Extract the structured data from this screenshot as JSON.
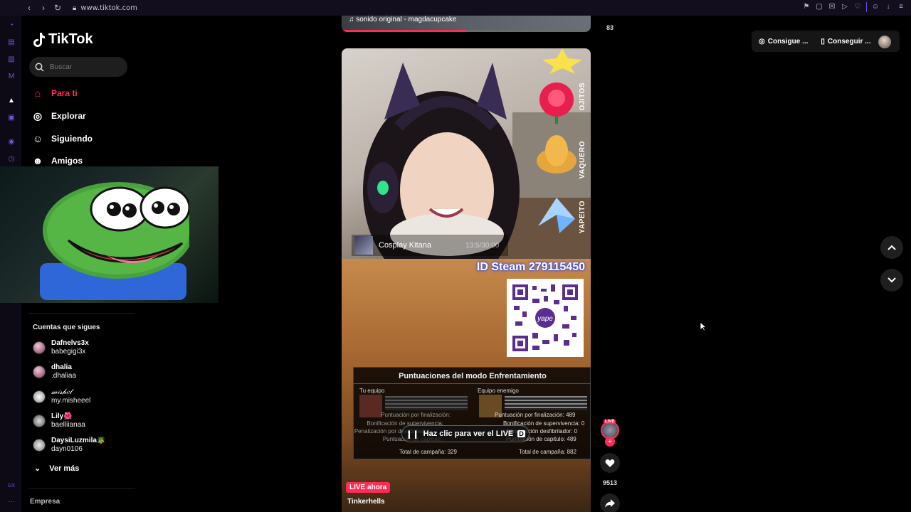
{
  "browser": {
    "url": "www.tiktok.com"
  },
  "sidebar": {
    "logo": "TikTok",
    "search_placeholder": "Buscar",
    "nav": [
      {
        "label": "Para ti",
        "icon": "home-icon",
        "active": true
      },
      {
        "label": "Explorar",
        "icon": "compass-icon",
        "active": false
      },
      {
        "label": "Siguiendo",
        "icon": "following-icon",
        "active": false
      },
      {
        "label": "Amigos",
        "icon": "friends-icon",
        "active": false
      }
    ],
    "following_title": "Cuentas que sigues",
    "accounts": [
      {
        "name": "Dafnelvs3x",
        "handle": "babegigi3x"
      },
      {
        "name": "dhalia",
        "handle": ".dhaliaa"
      },
      {
        "name": "𝓂𝒾𝓈𝒽𝑒𝓁",
        "handle": "my.misheeel"
      },
      {
        "name": "Lily🌺",
        "handle": "baelliianaa"
      },
      {
        "name": "DaysiLuzmila🪴",
        "handle": "dayn0106"
      }
    ],
    "see_more": "Ver más",
    "company": "Empresa"
  },
  "feed": {
    "prev_caption": "♫ sonido original - magdacupcake",
    "prev_progress": 0.5,
    "cosplay_title": "Cosplay Kitana",
    "cosplay_timer": "13:5/30:00",
    "gift_labels": [
      "OJITOS",
      "VAQUERO",
      "YAPEITO"
    ],
    "id_steam": "ID Steam 279115450",
    "qr_label": "yape",
    "score": {
      "title": "Puntuaciones del modo Enfrentamiento",
      "team_label": "Tu equipo",
      "enemy_label": "Equipo enemigo",
      "team_lines": [
        "Puntuación por finalización:",
        "Bonificación de supervivencia:",
        "Penalización por desfibrilador:",
        "Puntuación de capitulo:"
      ],
      "enemy_lines": [
        "Puntuación por finalización: 489",
        "Bonificación de supervivencia: 0",
        "Penalización desfibrilador: 0",
        "Puntuación de capitulo: 489"
      ],
      "team_total": "Total de campaña: 329",
      "enemy_total": "Total de campaña: 882"
    },
    "live_cta": "Haz clic para ver el LIVE",
    "live_now": "LIVE ahora",
    "live_host": "Tinkerhells"
  },
  "actions": {
    "prev_count": "83",
    "live_badge": "LIVE",
    "likes": "9513"
  },
  "topbar": {
    "coins_label": "Consigue ...",
    "app_label": "Conseguir ..."
  },
  "colors": {
    "accent": "#fe2c55",
    "background": "#000000",
    "steam_glow": "#1b3dff"
  }
}
